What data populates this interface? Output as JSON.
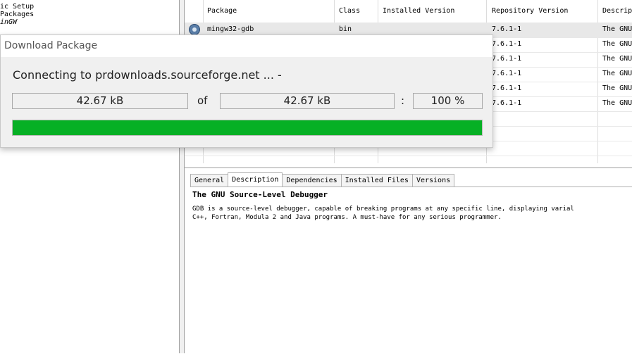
{
  "tree": {
    "items": [
      "ic Setup",
      " Packages",
      "inGW"
    ]
  },
  "table": {
    "headers": [
      "Package",
      "Class",
      "Installed Version",
      "Repository Version",
      "Descrip"
    ],
    "rows": [
      {
        "package": "mingw32-gdb",
        "class": "bin",
        "installed": "",
        "repo": "7.6.1-1",
        "desc": "The GNU",
        "selected": true,
        "icon": "package-icon"
      },
      {
        "package": "",
        "class": "",
        "installed": "",
        "repo": "7.6.1-1",
        "desc": "The GNU",
        "selected": false
      },
      {
        "package": "",
        "class": "",
        "installed": "",
        "repo": "7.6.1-1",
        "desc": "The GNU",
        "selected": false
      },
      {
        "package": "",
        "class": "",
        "installed": "",
        "repo": "7.6.1-1",
        "desc": "The GNU",
        "selected": false
      },
      {
        "package": "",
        "class": "",
        "installed": "",
        "repo": "7.6.1-1",
        "desc": "The GNU",
        "selected": false
      },
      {
        "package": "",
        "class": "",
        "installed": "",
        "repo": "7.6.1-1",
        "desc": "The GNU",
        "selected": false
      },
      {
        "package": "",
        "class": "",
        "installed": "",
        "repo": "",
        "desc": "",
        "selected": false
      },
      {
        "package": "",
        "class": "",
        "installed": "",
        "repo": "",
        "desc": "",
        "selected": false
      },
      {
        "package": "",
        "class": "",
        "installed": "",
        "repo": "",
        "desc": "",
        "selected": false
      },
      {
        "package": "",
        "class": "",
        "installed": "",
        "repo": "",
        "desc": "",
        "selected": false
      }
    ]
  },
  "details": {
    "tabs": [
      "General",
      "Description",
      "Dependencies",
      "Installed Files",
      "Versions"
    ],
    "active_tab": "Description",
    "title": "The GNU Source-Level Debugger",
    "body_line1": "GDB is a source-level debugger, capable of breaking programs at any specific line, displaying varial",
    "body_line2": "C++, Fortran, Modula 2 and Java programs. A must-have for any serious programmer."
  },
  "dialog": {
    "title": "Download Package",
    "status": "Connecting to prdownloads.sourceforge.net ... -",
    "downloaded": "42.67 kB",
    "of_label": "of",
    "total": "42.67 kB",
    "colon": ":",
    "percent": "100 %",
    "progress": 1.0,
    "progress_color": "#06b025"
  }
}
